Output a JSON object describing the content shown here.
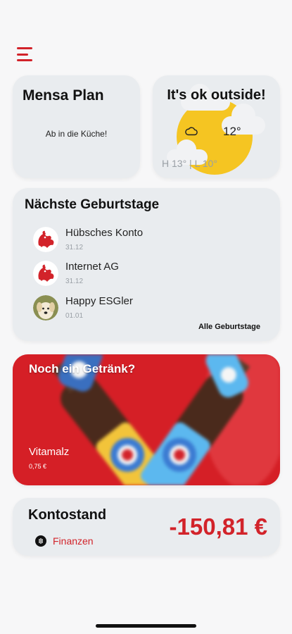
{
  "mensa": {
    "title": "Mensa Plan",
    "text": "Ab in die Küche!"
  },
  "weather": {
    "title": "It's ok outside!",
    "temp": "12°",
    "high_low": "H 13° | L 10°",
    "icon": "cloud-icon"
  },
  "birthdays": {
    "title": "Nächste Geburtstage",
    "items": [
      {
        "name": "Hübsches Konto",
        "date": "31.12",
        "avatar": "rooster-logo"
      },
      {
        "name": "Internet AG",
        "date": "31.12",
        "avatar": "rooster-logo"
      },
      {
        "name": "Happy ESGler",
        "date": "01.01",
        "avatar": "dog-photo"
      }
    ],
    "all_label": "Alle Geburtstage"
  },
  "drink": {
    "title": "Noch ein Getränk?",
    "name": "Vitamalz",
    "price": "0,75 €"
  },
  "account": {
    "title": "Kontostand",
    "link_label": "Finanzen",
    "balance": "-150,81 €"
  },
  "colors": {
    "accent": "#d2232a",
    "card": "#e9ecef",
    "background": "#f7f7f8",
    "sun": "#f5c522"
  }
}
